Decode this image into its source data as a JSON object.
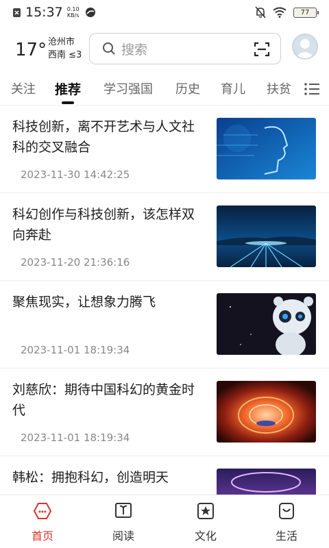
{
  "status_bar": {
    "time": "15:37",
    "speed_value": "0.10",
    "speed_unit": "KB/s",
    "battery": "77"
  },
  "header": {
    "temperature": "17°",
    "city": "沧州市",
    "wind": "西南 ≤3",
    "search_placeholder": "搜索"
  },
  "tabs": [
    {
      "label": "关注"
    },
    {
      "label": "推荐"
    },
    {
      "label": "学习强国"
    },
    {
      "label": "历史"
    },
    {
      "label": "育儿"
    },
    {
      "label": "扶贫"
    }
  ],
  "articles": [
    {
      "title": "科技创新，离不开艺术与人文社科的交叉融合",
      "time": "2023-11-30 14:42:25"
    },
    {
      "title": "科幻创作与科技创新，该怎样双向奔赴",
      "time": "2023-11-20 21:36:16"
    },
    {
      "title": "聚焦现实，让想象力腾飞",
      "time": "2023-11-01 18:19:34"
    },
    {
      "title": "刘慈欣：期待中国科幻的黄金时代",
      "time": "2023-11-01 18:19:34"
    },
    {
      "title": "韩松：拥抱科幻，创造明天",
      "time": ""
    }
  ],
  "bottom_nav": [
    {
      "label": "首页",
      "icon": "home-icon"
    },
    {
      "label": "阅读",
      "icon": "book-icon"
    },
    {
      "label": "文化",
      "icon": "star-badge-icon"
    },
    {
      "label": "生活",
      "icon": "smile-bag-icon"
    }
  ],
  "colors": {
    "accent": "#d9332c",
    "text": "#1d1d1d",
    "muted": "#888888"
  }
}
